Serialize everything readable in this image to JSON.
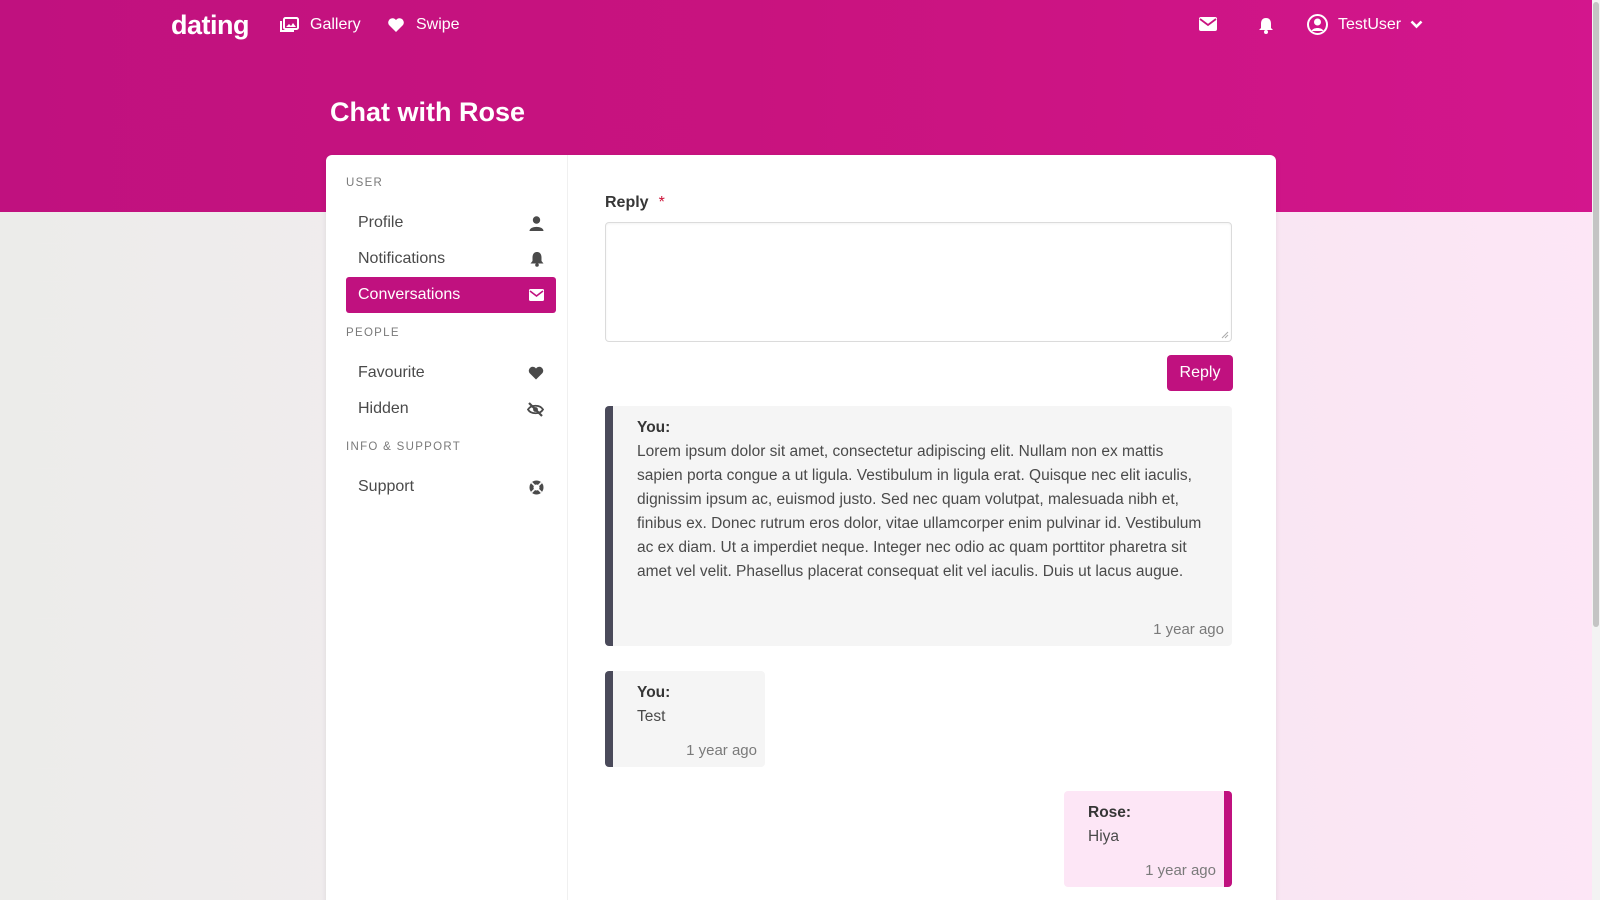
{
  "nav": {
    "brand": "dating",
    "gallery_label": "Gallery",
    "swipe_label": "Swipe",
    "username": "TestUser"
  },
  "page": {
    "title": "Chat with Rose"
  },
  "sidebar": {
    "sections": [
      {
        "label": "USER"
      },
      {
        "label": "PEOPLE"
      },
      {
        "label": "INFO & SUPPORT"
      }
    ],
    "items": [
      {
        "label": "Profile",
        "icon": "user-icon"
      },
      {
        "label": "Notifications",
        "icon": "bell-icon"
      },
      {
        "label": "Conversations",
        "icon": "envelope-icon",
        "active": true
      },
      {
        "label": "Favourite",
        "icon": "heart-icon"
      },
      {
        "label": "Hidden",
        "icon": "eye-slash-icon"
      },
      {
        "label": "Support",
        "icon": "life-ring-icon"
      }
    ]
  },
  "form": {
    "reply_label": "Reply",
    "required_mark": "*",
    "reply_value": "",
    "reply_button": "Reply"
  },
  "messages": [
    {
      "author": "You:",
      "body": "Lorem ipsum dolor sit amet, consectetur adipiscing elit. Nullam non ex mattis sapien porta congue a ut ligula. Vestibulum in ligula erat. Quisque nec elit iaculis, dignissim ipsum ac, euismod justo. Sed nec quam volutpat, malesuada nibh et, finibus ex. Donec rutrum eros dolor, vitae ullamcorper enim pulvinar id. Vestibulum ac ex diam. Ut a imperdiet neque. Integer nec odio ac quam porttitor pharetra sit amet vel velit. Phasellus placerat consequat elit vel iaculis. Duis ut lacus augue.",
      "time": "1 year ago"
    },
    {
      "author": "You:",
      "body": "Test",
      "time": "1 year ago"
    },
    {
      "author": "Rose:",
      "body": "Hiya",
      "time": "1 year ago"
    }
  ],
  "colors": {
    "accent": "#c0117f",
    "own_message_bar": "#4a4a5a",
    "their_message_bg": "#fde6f6"
  }
}
